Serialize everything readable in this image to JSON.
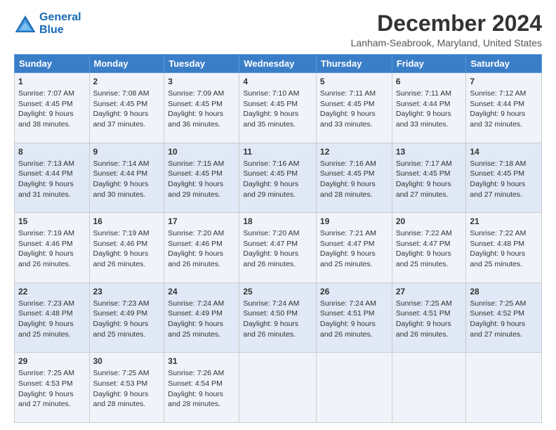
{
  "logo": {
    "line1": "General",
    "line2": "Blue"
  },
  "title": "December 2024",
  "subtitle": "Lanham-Seabrook, Maryland, United States",
  "days_of_week": [
    "Sunday",
    "Monday",
    "Tuesday",
    "Wednesday",
    "Thursday",
    "Friday",
    "Saturday"
  ],
  "weeks": [
    [
      {
        "day": "1",
        "sunrise": "7:07 AM",
        "sunset": "4:45 PM",
        "daylight": "9 hours and 38 minutes."
      },
      {
        "day": "2",
        "sunrise": "7:08 AM",
        "sunset": "4:45 PM",
        "daylight": "9 hours and 37 minutes."
      },
      {
        "day": "3",
        "sunrise": "7:09 AM",
        "sunset": "4:45 PM",
        "daylight": "9 hours and 36 minutes."
      },
      {
        "day": "4",
        "sunrise": "7:10 AM",
        "sunset": "4:45 PM",
        "daylight": "9 hours and 35 minutes."
      },
      {
        "day": "5",
        "sunrise": "7:11 AM",
        "sunset": "4:45 PM",
        "daylight": "9 hours and 33 minutes."
      },
      {
        "day": "6",
        "sunrise": "7:11 AM",
        "sunset": "4:44 PM",
        "daylight": "9 hours and 33 minutes."
      },
      {
        "day": "7",
        "sunrise": "7:12 AM",
        "sunset": "4:44 PM",
        "daylight": "9 hours and 32 minutes."
      }
    ],
    [
      {
        "day": "8",
        "sunrise": "7:13 AM",
        "sunset": "4:44 PM",
        "daylight": "9 hours and 31 minutes."
      },
      {
        "day": "9",
        "sunrise": "7:14 AM",
        "sunset": "4:44 PM",
        "daylight": "9 hours and 30 minutes."
      },
      {
        "day": "10",
        "sunrise": "7:15 AM",
        "sunset": "4:45 PM",
        "daylight": "9 hours and 29 minutes."
      },
      {
        "day": "11",
        "sunrise": "7:16 AM",
        "sunset": "4:45 PM",
        "daylight": "9 hours and 29 minutes."
      },
      {
        "day": "12",
        "sunrise": "7:16 AM",
        "sunset": "4:45 PM",
        "daylight": "9 hours and 28 minutes."
      },
      {
        "day": "13",
        "sunrise": "7:17 AM",
        "sunset": "4:45 PM",
        "daylight": "9 hours and 27 minutes."
      },
      {
        "day": "14",
        "sunrise": "7:18 AM",
        "sunset": "4:45 PM",
        "daylight": "9 hours and 27 minutes."
      }
    ],
    [
      {
        "day": "15",
        "sunrise": "7:19 AM",
        "sunset": "4:46 PM",
        "daylight": "9 hours and 26 minutes."
      },
      {
        "day": "16",
        "sunrise": "7:19 AM",
        "sunset": "4:46 PM",
        "daylight": "9 hours and 26 minutes."
      },
      {
        "day": "17",
        "sunrise": "7:20 AM",
        "sunset": "4:46 PM",
        "daylight": "9 hours and 26 minutes."
      },
      {
        "day": "18",
        "sunrise": "7:20 AM",
        "sunset": "4:47 PM",
        "daylight": "9 hours and 26 minutes."
      },
      {
        "day": "19",
        "sunrise": "7:21 AM",
        "sunset": "4:47 PM",
        "daylight": "9 hours and 25 minutes."
      },
      {
        "day": "20",
        "sunrise": "7:22 AM",
        "sunset": "4:47 PM",
        "daylight": "9 hours and 25 minutes."
      },
      {
        "day": "21",
        "sunrise": "7:22 AM",
        "sunset": "4:48 PM",
        "daylight": "9 hours and 25 minutes."
      }
    ],
    [
      {
        "day": "22",
        "sunrise": "7:23 AM",
        "sunset": "4:48 PM",
        "daylight": "9 hours and 25 minutes."
      },
      {
        "day": "23",
        "sunrise": "7:23 AM",
        "sunset": "4:49 PM",
        "daylight": "9 hours and 25 minutes."
      },
      {
        "day": "24",
        "sunrise": "7:24 AM",
        "sunset": "4:49 PM",
        "daylight": "9 hours and 25 minutes."
      },
      {
        "day": "25",
        "sunrise": "7:24 AM",
        "sunset": "4:50 PM",
        "daylight": "9 hours and 26 minutes."
      },
      {
        "day": "26",
        "sunrise": "7:24 AM",
        "sunset": "4:51 PM",
        "daylight": "9 hours and 26 minutes."
      },
      {
        "day": "27",
        "sunrise": "7:25 AM",
        "sunset": "4:51 PM",
        "daylight": "9 hours and 26 minutes."
      },
      {
        "day": "28",
        "sunrise": "7:25 AM",
        "sunset": "4:52 PM",
        "daylight": "9 hours and 27 minutes."
      }
    ],
    [
      {
        "day": "29",
        "sunrise": "7:25 AM",
        "sunset": "4:53 PM",
        "daylight": "9 hours and 27 minutes."
      },
      {
        "day": "30",
        "sunrise": "7:25 AM",
        "sunset": "4:53 PM",
        "daylight": "9 hours and 28 minutes."
      },
      {
        "day": "31",
        "sunrise": "7:26 AM",
        "sunset": "4:54 PM",
        "daylight": "9 hours and 28 minutes."
      },
      null,
      null,
      null,
      null
    ]
  ],
  "labels": {
    "sunrise": "Sunrise:",
    "sunset": "Sunset:",
    "daylight": "Daylight:"
  }
}
